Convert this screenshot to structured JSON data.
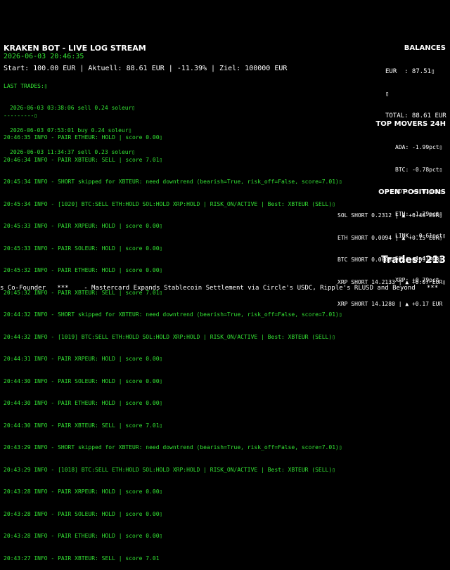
{
  "header": {
    "title": "KRAKEN BOT - LIVE LOG STREAM",
    "datetime": "2026-06-03 20:46:35",
    "summary": "Start: 100.00 EUR | Aktuell: 88.61 EUR | -11.39% | Ziel: 100000 EUR"
  },
  "last_trades": {
    "heading": "LAST TRADES:▯",
    "items": [
      "2026-06-03 03:38:06 sell 0.24 soleur▯",
      "2026-06-03 07:53:01 buy 0.24 soleur▯",
      "2026-06-03 11:34:37 sell 0.23 soleur▯"
    ],
    "separator": "---------▯"
  },
  "log_lines": [
    "20:46:35 INFO - PAIR ETHEUR: HOLD | score 0.00▯",
    "20:46:34 INFO - PAIR XBTEUR: SELL | score 7.01▯",
    "20:45:34 INFO - SHORT skipped for XBTEUR: need downtrend (bearish=True, risk_off=False, score=7.01)▯",
    "20:45:34 INFO - [1020] BTC:SELL ETH:HOLD SOL:HOLD XRP:HOLD | RISK_ON/ACTIVE | Best: XBTEUR (SELL)▯",
    "20:45:33 INFO - PAIR XRPEUR: HOLD | score 0.00▯",
    "20:45:33 INFO - PAIR SOLEUR: HOLD | score 0.00▯",
    "20:45:32 INFO - PAIR ETHEUR: HOLD | score 0.00▯",
    "20:45:32 INFO - PAIR XBTEUR: SELL | score 7.01▯",
    "20:44:32 INFO - SHORT skipped for XBTEUR: need downtrend (bearish=True, risk_off=False, score=7.01)▯",
    "20:44:32 INFO - [1019] BTC:SELL ETH:HOLD SOL:HOLD XRP:HOLD | RISK_ON/ACTIVE | Best: XBTEUR (SELL)▯",
    "20:44:31 INFO - PAIR XRPEUR: HOLD | score 0.00▯",
    "20:44:30 INFO - PAIR SOLEUR: HOLD | score 0.00▯",
    "20:44:30 INFO - PAIR ETHEUR: HOLD | score 0.00▯",
    "20:44:30 INFO - PAIR XBTEUR: SELL | score 7.01▯",
    "20:43:29 INFO - SHORT skipped for XBTEUR: need downtrend (bearish=True, risk_off=False, score=7.01)▯",
    "20:43:29 INFO - [1018] BTC:SELL ETH:HOLD SOL:HOLD XRP:HOLD | RISK_ON/ACTIVE | Best: XBTEUR (SELL)▯",
    "20:43:28 INFO - PAIR XRPEUR: HOLD | score 0.00▯",
    "20:43:28 INFO - PAIR SOLEUR: HOLD | score 0.00▯",
    "20:43:28 INFO - PAIR ETHEUR: HOLD | score 0.00▯",
    "20:43:27 INFO - PAIR XBTEUR: SELL | score 7.01"
  ],
  "balances": {
    "heading": "BALANCES",
    "lines": [
      "EUR  : 87.51▯",
      "▯",
      "TOTAL: 88.61 EUR"
    ]
  },
  "top_movers": {
    "heading": "TOP MOVERS 24H",
    "lines": [
      "ADA: -1.99pct▯",
      "BTC: -0.78pct▯",
      "DOT: +3.03pct▯",
      "ETH: -1.29pct▯",
      "LINK: -0.61pct▯",
      "SOL: -1.47pct▯",
      "XRP: +0.79pct"
    ]
  },
  "open_positions": {
    "heading": "OPEN POSITIONS",
    "lines": [
      "SOL SHORT 0.2312 | ▲ +0.46 EUR▯",
      "ETH SHORT 0.0094 | ▲ +0.15 EUR▯",
      "BTC SHORT 0.0003 | ▲ +0.09 EUR▯",
      "XRP SHORT 14.2133 | ▲ +0.07 EUR▯",
      "XRP SHORT 14.1280 | ▲ +0.17 EUR"
    ]
  },
  "trades_count": "Trades: 213",
  "ticker": "s Co-Founder   ***    - Mastercard Expands Stablecoin Settlement via Circle's USDC, Ripple's RLUSD and Beyond   ***"
}
